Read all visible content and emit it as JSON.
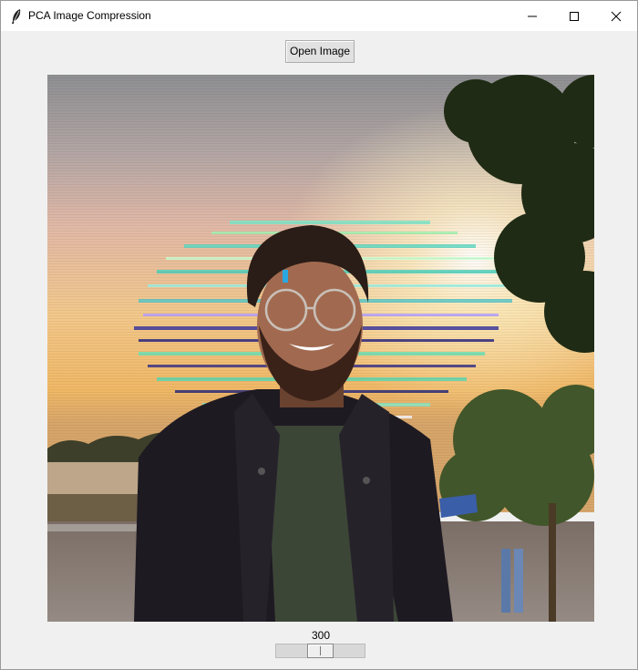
{
  "window": {
    "title": "PCA Image Compression",
    "controls": [
      "minimize",
      "maximize",
      "close"
    ]
  },
  "toolbar": {
    "open_label": "Open Image"
  },
  "image": {
    "description_icon": "image-icon"
  },
  "slider": {
    "value": "300",
    "fraction": 0.5
  },
  "colors": {
    "window_bg": "#f0f0f0",
    "titlebar_bg": "#ffffff",
    "button_bg": "#e1e1e1"
  }
}
